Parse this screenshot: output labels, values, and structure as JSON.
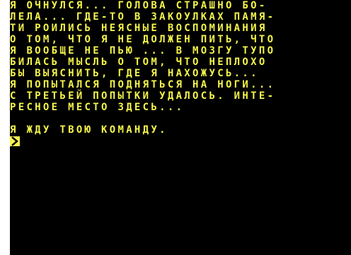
{
  "screen": {
    "story_lines": [
      "я очнулся... голова страшно бо-",
      "лела... где-то в закоулках памя-",
      "ти роились неясные воспоминания",
      "о том, что я не должен пить, что",
      "я вообще не пью ... в мозгу тупо",
      "билась мысль о том, что неплохо",
      "бы выяснить, где я нахожусь...",
      "я попытался подняться на ноги...",
      "с третьей попытки удалось. инте-",
      "ресное место здесь..."
    ],
    "prompt_text": "я жду твою команду."
  },
  "colors": {
    "text": "#f4f44c",
    "background": "#000000"
  },
  "icons": {
    "cursor": "input-cursor-icon"
  }
}
